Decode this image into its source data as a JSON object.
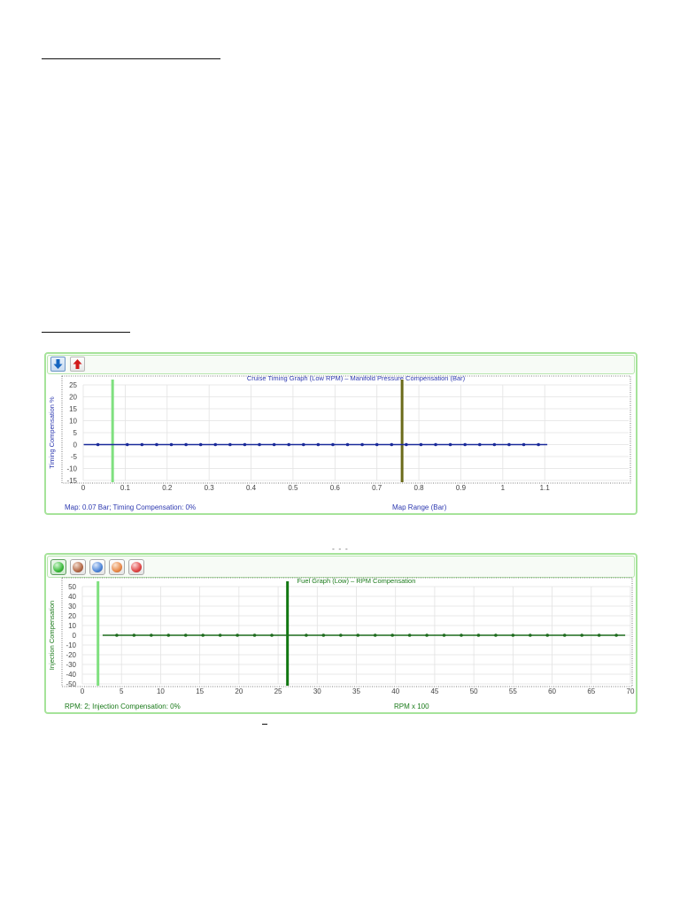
{
  "timing_panel": {
    "status_text": "Map: 0.07 Bar; Timing Compensation: 0%",
    "toolbar_icons": [
      "arrow-down-icon",
      "arrow-up-icon"
    ],
    "colors": {
      "frame": "#a6e39a",
      "title": "#2e3ab0",
      "series": "#1a2a9a",
      "marker_current": "#7fe07f",
      "marker_selected": "#6b6b1a"
    }
  },
  "fuel_panel": {
    "status_text": "RPM: 2; Injection Compensation: 0%",
    "toolbar_icons": [
      "green-orb-icon",
      "brown-orb-icon",
      "blue-orb-icon",
      "orange-orb-icon",
      "red-orb-icon"
    ],
    "colors": {
      "frame": "#a6e39a",
      "title": "#1a7a1a",
      "series": "#1d6b1d",
      "marker_current": "#7fe07f",
      "marker_selected": "#117711"
    }
  },
  "chart_data": [
    {
      "type": "line",
      "title": "Cruise Timing Graph (Low RPM) – Manifold Pressure Compensation (Bar)",
      "xlabel": "Map Range (Bar)",
      "ylabel": "Timing Compensation %",
      "xlim": [
        0,
        1.3
      ],
      "ylim": [
        -15,
        25
      ],
      "xticks": [
        0,
        0.1,
        0.2,
        0.3,
        0.4,
        0.5,
        0.6,
        0.7,
        0.8,
        0.9,
        1,
        1.1
      ],
      "xtick_labels": [
        "0",
        "0.1",
        "0.2",
        "0.3",
        "0.4",
        "0.5",
        "0.6",
        "0.7",
        "0.8",
        "0.9",
        "1",
        "1.1"
      ],
      "yticks": [
        25,
        20,
        15,
        10,
        5,
        0,
        -5,
        -10,
        -15
      ],
      "grid": true,
      "series": [
        {
          "x": [
            0.035,
            0.105,
            0.14,
            0.175,
            0.21,
            0.245,
            0.28,
            0.315,
            0.35,
            0.385,
            0.42,
            0.455,
            0.49,
            0.525,
            0.56,
            0.595,
            0.63,
            0.665,
            0.7,
            0.735,
            0.77,
            0.805,
            0.84,
            0.875,
            0.91,
            0.945,
            0.98,
            1.015,
            1.05,
            1.085
          ],
          "y": [
            0,
            0,
            0,
            0,
            0,
            0,
            0,
            0,
            0,
            0,
            0,
            0,
            0,
            0,
            0,
            0,
            0,
            0,
            0,
            0,
            0,
            0,
            0,
            0,
            0,
            0,
            0,
            0,
            0,
            0
          ]
        }
      ],
      "vertical_markers": [
        0.07,
        0.76
      ]
    },
    {
      "type": "line",
      "title": "Fuel Graph (Low) – RPM Compensation",
      "xlabel": "RPM x 100",
      "ylabel": "Injection Compensation",
      "xlim": [
        0,
        70
      ],
      "ylim": [
        -50,
        50
      ],
      "xticks": [
        0,
        5,
        10,
        15,
        20,
        25,
        30,
        35,
        40,
        45,
        50,
        55,
        60,
        65,
        70
      ],
      "yticks": [
        50,
        40,
        30,
        20,
        10,
        0,
        -10,
        -20,
        -30,
        -40,
        -50
      ],
      "grid": true,
      "series": [
        {
          "x": [
            4.4,
            6.6,
            8.8,
            11,
            13.2,
            15.4,
            17.6,
            19.8,
            22,
            24.2,
            28.6,
            30.8,
            33,
            35.2,
            37.4,
            39.6,
            41.8,
            44,
            46.2,
            48.4,
            50.6,
            52.8,
            55,
            57.2,
            59.4,
            61.6,
            63.8,
            66,
            68.2
          ],
          "y": [
            0,
            0,
            0,
            0,
            0,
            0,
            0,
            0,
            0,
            0,
            0,
            0,
            0,
            0,
            0,
            0,
            0,
            0,
            0,
            0,
            0,
            0,
            0,
            0,
            0,
            0,
            0,
            0,
            0
          ]
        }
      ],
      "vertical_markers": [
        2,
        26.2
      ]
    }
  ]
}
